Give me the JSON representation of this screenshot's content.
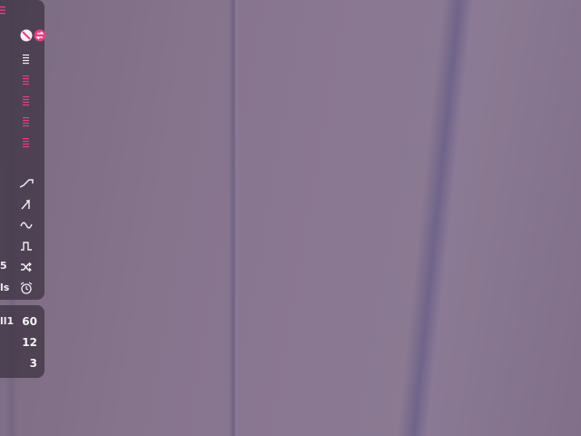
{
  "colors": {
    "accent": "#e6407f",
    "panel": "#3a3040",
    "text": "#f2eef4"
  },
  "top_panel": {
    "menu_icon": "hamburger-icon",
    "flag_icons": [
      "no-entry-icon",
      "swap-icon"
    ],
    "channels": [
      {
        "icon": "menu-lines-icon",
        "accent": false
      },
      {
        "icon": "menu-lines-icon",
        "accent": true
      },
      {
        "icon": "menu-lines-icon",
        "accent": true
      },
      {
        "icon": "menu-lines-icon",
        "accent": true
      },
      {
        "icon": "menu-lines-icon",
        "accent": true
      }
    ],
    "modes": [
      {
        "icon": "ramp-up-icon"
      },
      {
        "icon": "sawtooth-icon"
      },
      {
        "icon": "sine-wave-icon"
      },
      {
        "icon": "square-wave-icon"
      },
      {
        "label": "5",
        "icon": "shuffle-icon"
      },
      {
        "label": "ls",
        "icon": "alarm-clock-icon"
      }
    ]
  },
  "bottom_panel": {
    "rows": [
      {
        "label": "ll1",
        "value": "60"
      },
      {
        "label": "",
        "value": "12"
      },
      {
        "label": "",
        "value": "3"
      }
    ]
  }
}
